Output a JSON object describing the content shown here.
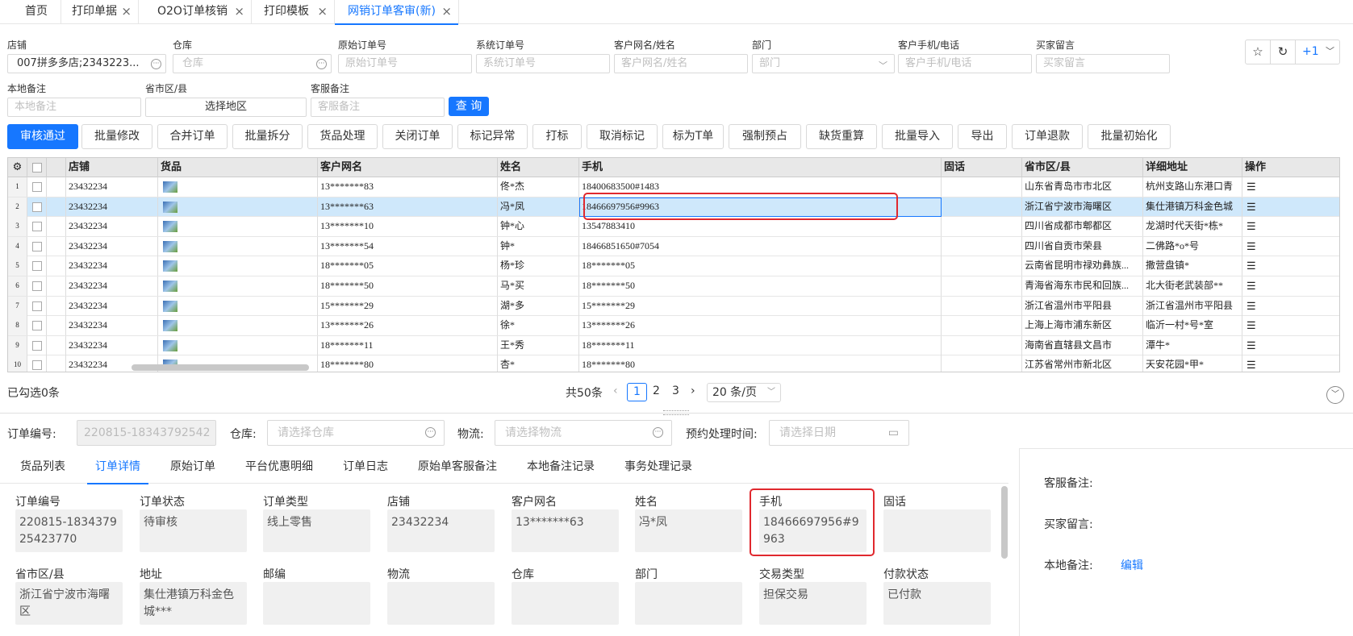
{
  "tabs": [
    {
      "label": "首页",
      "close": ""
    },
    {
      "label": "打印单据",
      "close": "×"
    },
    {
      "label": "O2O订单核销",
      "close": "×"
    },
    {
      "label": "打印模板",
      "close": "×"
    },
    {
      "label": "网销订单客审(新)",
      "close": "×"
    }
  ],
  "filters": {
    "shop": {
      "label": "店铺",
      "value": "007拼多多店;2343223..."
    },
    "warehouse": {
      "label": "仓库",
      "placeholder": "仓库"
    },
    "orig_order": {
      "label": "原始订单号",
      "placeholder": "原始订单号"
    },
    "sys_order": {
      "label": "系统订单号",
      "placeholder": "系统订单号"
    },
    "customer": {
      "label": "客户网名/姓名",
      "placeholder": "客户网名/姓名"
    },
    "dept": {
      "label": "部门",
      "placeholder": "部门"
    },
    "phone": {
      "label": "客户手机/电话",
      "placeholder": "客户手机/电话"
    },
    "buyer_msg": {
      "label": "买家留言",
      "placeholder": "买家留言"
    },
    "local_note": {
      "label": "本地备注",
      "placeholder": "本地备注"
    },
    "region": {
      "label": "省市区/县",
      "value": "选择地区"
    },
    "cs_note": {
      "label": "客服备注",
      "placeholder": "客服备注"
    },
    "query": "查 询",
    "plus_one": "+1"
  },
  "actions": [
    "审核通过",
    "批量修改",
    "合并订单",
    "批量拆分",
    "货品处理",
    "关闭订单",
    "标记异常",
    "打标",
    "取消标记",
    "标为T单",
    "强制预占",
    "缺货重算",
    "批量导入",
    "导出",
    "订单退款",
    "批量初始化"
  ],
  "grid": {
    "headers": [
      "店铺",
      "货品",
      "客户网名",
      "姓名",
      "手机",
      "固话",
      "省市区/县",
      "详细地址",
      "操作"
    ],
    "rows": [
      {
        "n": "1",
        "shop": "23432234",
        "cust": "13*******83",
        "name": "佟*杰",
        "phone": "18400683500#1483",
        "tel": "",
        "region": "山东省青岛市市北区",
        "addr": "杭州支路山东港口青"
      },
      {
        "n": "2",
        "shop": "23432234",
        "cust": "13*******63",
        "name": "冯*凤",
        "phone": "18466697956#9963",
        "tel": "",
        "region": "浙江省宁波市海曙区",
        "addr": "集仕港镇万科金色城"
      },
      {
        "n": "3",
        "shop": "23432234",
        "cust": "13*******10",
        "name": "钟*心",
        "phone": "13547883410",
        "tel": "",
        "region": "四川省成都市郫都区",
        "addr": "龙湖时代天街*栋*"
      },
      {
        "n": "4",
        "shop": "23432234",
        "cust": "13*******54",
        "name": "钟*",
        "phone": "18466851650#7054",
        "tel": "",
        "region": "四川省自贡市荣县",
        "addr": "二佛路*o*号"
      },
      {
        "n": "5",
        "shop": "23432234",
        "cust": "18*******05",
        "name": "杨*珍",
        "phone": "18*******05",
        "tel": "",
        "region": "云南省昆明市禄劝彝族...",
        "addr": "撒营盘镇*"
      },
      {
        "n": "6",
        "shop": "23432234",
        "cust": "18*******50",
        "name": "马*买",
        "phone": "18*******50",
        "tel": "",
        "region": "青海省海东市民和回族...",
        "addr": "北大街老武装部**"
      },
      {
        "n": "7",
        "shop": "23432234",
        "cust": "15*******29",
        "name": "湖*多",
        "phone": "15*******29",
        "tel": "",
        "region": "浙江省温州市平阳县",
        "addr": "浙江省温州市平阳县"
      },
      {
        "n": "8",
        "shop": "23432234",
        "cust": "13*******26",
        "name": "徐*",
        "phone": "13*******26",
        "tel": "",
        "region": "上海上海市浦东新区",
        "addr": "临沂一村*号*室"
      },
      {
        "n": "9",
        "shop": "23432234",
        "cust": "18*******11",
        "name": "王*秀",
        "phone": "18*******11",
        "tel": "",
        "region": "海南省直辖县文昌市",
        "addr": "潭牛*"
      },
      {
        "n": "10",
        "shop": "23432234",
        "cust": "18*******80",
        "name": "杏*",
        "phone": "18*******80",
        "tel": "",
        "region": "江苏省常州市新北区",
        "addr": "天安花园*甲*"
      }
    ]
  },
  "footer": {
    "checked": "已勾选0条",
    "total": "共50条",
    "pages": [
      "1",
      "2",
      "3"
    ],
    "page_size": "20 条/页"
  },
  "order_bar": {
    "order_no_label": "订单编号:",
    "order_no": "220815-18343792542",
    "wh_label": "仓库:",
    "wh_placeholder": "请选择仓库",
    "log_label": "物流:",
    "log_placeholder": "请选择物流",
    "time_label": "预约处理时间:",
    "time_placeholder": "请选择日期"
  },
  "detail_tabs": [
    "货品列表",
    "订单详情",
    "原始订单",
    "平台优惠明细",
    "订单日志",
    "原始单客服备注",
    "本地备注记录",
    "事务处理记录"
  ],
  "fields": [
    {
      "label": "订单编号",
      "value": "220815-183437925423770"
    },
    {
      "label": "订单状态",
      "value": "待审核"
    },
    {
      "label": "订单类型",
      "value": "线上零售"
    },
    {
      "label": "店铺",
      "value": "23432234"
    },
    {
      "label": "客户网名",
      "value": "13*******63"
    },
    {
      "label": "姓名",
      "value": "冯*凤"
    },
    {
      "label": "手机",
      "value": "18466697956#9963"
    },
    {
      "label": "固话",
      "value": ""
    },
    {
      "label": "省市区/县",
      "value": "浙江省宁波市海曙区"
    },
    {
      "label": "地址",
      "value": "集仕港镇万科金色城***"
    },
    {
      "label": "邮编",
      "value": ""
    },
    {
      "label": "物流",
      "value": ""
    },
    {
      "label": "仓库",
      "value": ""
    },
    {
      "label": "部门",
      "value": ""
    },
    {
      "label": "交易类型",
      "value": "担保交易"
    },
    {
      "label": "付款状态",
      "value": "已付款"
    }
  ],
  "side": {
    "cs_note": "客服备注:",
    "buyer_msg": "买家留言:",
    "local_note": "本地备注:",
    "edit": "编辑"
  }
}
